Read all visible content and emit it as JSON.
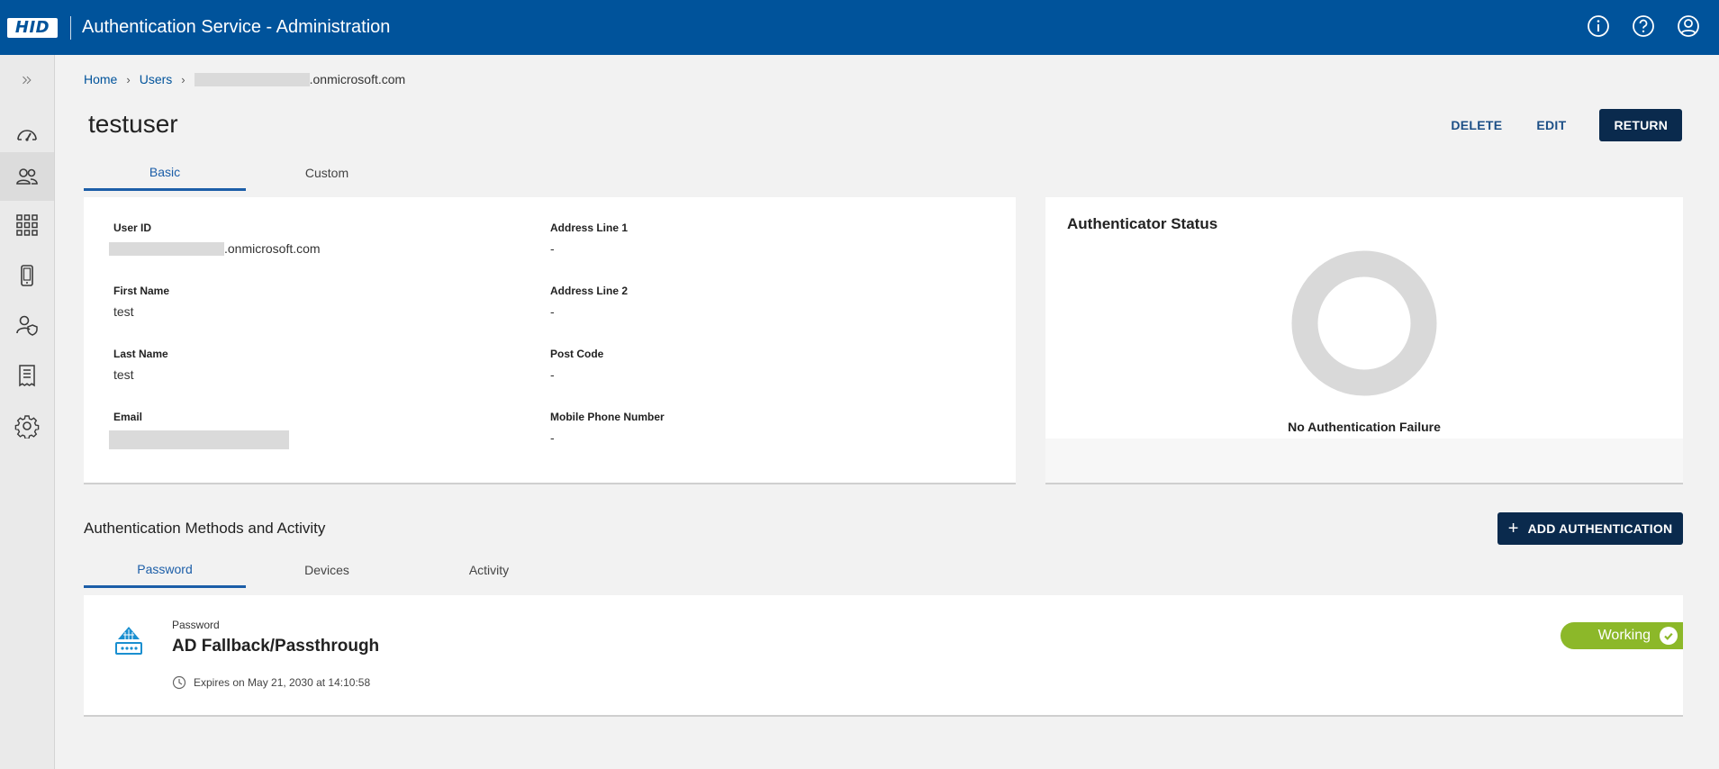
{
  "header": {
    "logo_text": "HID",
    "app_title": "Authentication Service - Administration",
    "icons": [
      "info-icon",
      "help-icon",
      "account-icon"
    ]
  },
  "sidebar": {
    "items": [
      {
        "name": "expand",
        "icon": "double-chevron-right-icon"
      },
      {
        "name": "dashboard",
        "icon": "speedometer-icon"
      },
      {
        "name": "users",
        "icon": "users-icon",
        "active": true
      },
      {
        "name": "applications",
        "icon": "grid-icon"
      },
      {
        "name": "devices",
        "icon": "mobile-device-icon"
      },
      {
        "name": "user-security",
        "icon": "user-shield-icon"
      },
      {
        "name": "reports",
        "icon": "receipt-icon"
      },
      {
        "name": "settings",
        "icon": "gear-icon"
      }
    ]
  },
  "breadcrumb": {
    "home": "Home",
    "users": "Users",
    "current_suffix": ".onmicrosoft.com"
  },
  "page": {
    "title": "testuser",
    "delete_label": "DELETE",
    "edit_label": "EDIT",
    "return_label": "RETURN"
  },
  "detail_tabs": [
    {
      "label": "Basic",
      "active": true
    },
    {
      "label": "Custom",
      "active": false
    }
  ],
  "user_fields": {
    "user_id": {
      "label": "User ID",
      "value_suffix": ".onmicrosoft.com"
    },
    "first_name": {
      "label": "First Name",
      "value": "test"
    },
    "last_name": {
      "label": "Last Name",
      "value": "test"
    },
    "email": {
      "label": "Email"
    },
    "address1": {
      "label": "Address Line 1",
      "value": "-"
    },
    "address2": {
      "label": "Address Line 2",
      "value": "-"
    },
    "post_code": {
      "label": "Post Code",
      "value": "-"
    },
    "mobile": {
      "label": "Mobile Phone Number",
      "value": "-"
    }
  },
  "authenticator_status": {
    "title": "Authenticator Status",
    "message": "No Authentication Failure"
  },
  "methods": {
    "section_title": "Authentication Methods and Activity",
    "add_label": "ADD AUTHENTICATION",
    "tabs": [
      {
        "label": "Password",
        "active": true
      },
      {
        "label": "Devices",
        "active": false
      },
      {
        "label": "Activity",
        "active": false
      }
    ],
    "items": [
      {
        "type": "Password",
        "name": "AD Fallback/Passthrough",
        "expiry": "Expires on May 21, 2030 at 14:10:58",
        "status": "Working",
        "icon": "password-key-icon"
      }
    ]
  },
  "colors": {
    "brand": "#00539b",
    "primary_button": "#0a2a4d",
    "active_tab": "#1c5ea8",
    "working": "#8cb829"
  }
}
